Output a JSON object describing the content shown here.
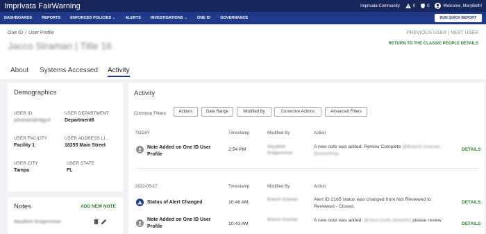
{
  "app": {
    "brand": "Imprivata FairWarning",
    "community": "Imprivata Community",
    "alert_count": "0",
    "shield_count": "0",
    "welcome": "Welcome, MaryBeth!"
  },
  "nav": {
    "items": [
      "DASHBOARDS",
      "REPORTS",
      "ENFORCED POLICIES",
      "ALERTS",
      "INVESTIGATIONS",
      "ONE ID",
      "GOVERNANCE"
    ],
    "dropdown_mark": "⌄",
    "quick_report": "RUN QUICK REPORT"
  },
  "header": {
    "breadcrumb_root": "One ID",
    "breadcrumb_sep": "/",
    "breadcrumb_current": "User Profile",
    "person_name": "Jacco Straman | Title 16",
    "previous_user": "PREVIOUS USER",
    "next_user": "NEXT USER",
    "pager_sep": "|",
    "return_link": "RETURN TO THE CLASSIC PEOPLE DETAILS"
  },
  "tabs": {
    "about": "About",
    "systems": "Systems Accessed",
    "activity": "Activity"
  },
  "demographics": {
    "title": "Demographics",
    "user_id_label": "USER ID",
    "user_id_value": "jstraman@rdgy.tl",
    "dept_label": "USER DEPARTMENT",
    "dept_value": "Department6",
    "facility_label": "USER FACILITY",
    "facility_value": "Facility 1",
    "address_label": "USER ADDRESS LI...",
    "address_value": "18255 Main Street",
    "city_label": "USER CITY",
    "city_value": "Tampa",
    "state_label": "USER STATE",
    "state_value": "FL"
  },
  "notes": {
    "title": "Notes",
    "add": "ADD NEW NOTE",
    "author": "MaryBeth Bridgemohan"
  },
  "activity": {
    "title": "Activity",
    "filters_label": "Common Filters",
    "filters": [
      "Actions",
      "Date Range",
      "Modified By",
      "Corrective Actions",
      "Advanced Filters"
    ],
    "groups": [
      {
        "date": "TODAY",
        "col_ts": "Timestamp",
        "col_by": "Modified By",
        "col_action": "Action"
      },
      {
        "date": "2022-05-17",
        "col_ts": "Timestamp",
        "col_by": "Modified By",
        "col_action": "Action"
      }
    ],
    "rows": [
      {
        "title": "Note Added on One ID User Profile",
        "ts": "2:54 PM",
        "by": "MaryBeth Bridgemohan",
        "action_pre": "A new note was added: Review Complete",
        "action_blur": "@Branch Graman (branchling)",
        "details": "DETAILS",
        "icon": "person-icon"
      },
      {
        "title": "Status of Alert Changed",
        "ts": "10:46 AM",
        "by": "Branch Graman",
        "action_pre": "Alert ID 2165 status was changed from Not Reviewed to Reviewed - Closed.",
        "action_blur": "",
        "details": "DETAILS",
        "icon": "alert-icon"
      },
      {
        "title": "Note Added on One ID User Profile",
        "ts": "10:43 AM",
        "by": "Branch Graman",
        "action_pre": "A new note was added:",
        "action_blur": "@Jaco Earle (bearths)",
        "action_post": "please review",
        "details": "DETAILS",
        "icon": "person-icon"
      }
    ]
  }
}
